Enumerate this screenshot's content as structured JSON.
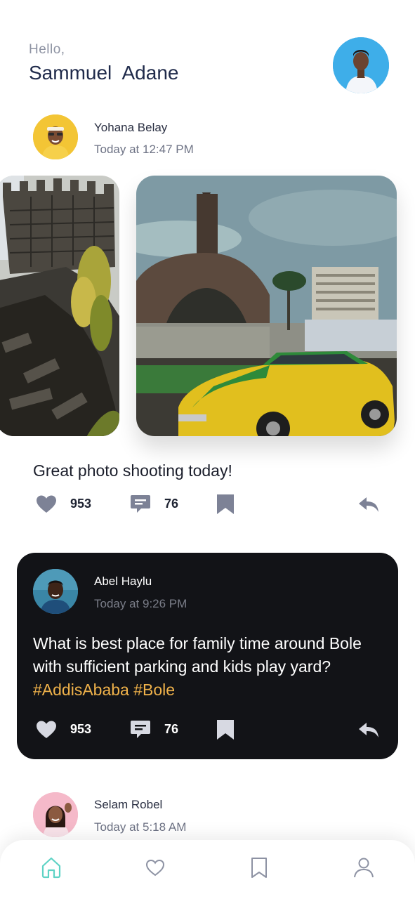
{
  "header": {
    "greeting": "Hello,",
    "user_name": "Sammuel  Adane"
  },
  "posts": [
    {
      "author": "Yohana Belay",
      "time": "Today at 12:47 PM",
      "text": "Great photo shooting today!",
      "likes": "953",
      "comments": "76",
      "theme": "light"
    },
    {
      "author": "Abel Haylu",
      "time": "Today at 9:26 PM",
      "text": "What is best place for family time around Bole with sufficient parking and kids play yard?",
      "hashtags": "#AddisAbaba #Bole",
      "likes": "953",
      "comments": "76",
      "theme": "dark"
    },
    {
      "author": "Selam Robel",
      "time": "Today at 5:18 AM"
    }
  ],
  "icons": {
    "like": "heart-icon",
    "comment": "comment-icon",
    "save": "bookmark-icon",
    "share": "reply-icon"
  },
  "bottom_nav": [
    {
      "icon": "home-icon",
      "active": true
    },
    {
      "icon": "heart-icon",
      "active": false
    },
    {
      "icon": "bookmark-icon",
      "active": false
    },
    {
      "icon": "profile-icon",
      "active": false
    }
  ],
  "colors": {
    "accent": "#5ed3c5",
    "hashtag": "#f0b24a",
    "dark_card": "#121317",
    "icon_light": "#7d8296",
    "icon_dark": "#d7d9e2"
  }
}
